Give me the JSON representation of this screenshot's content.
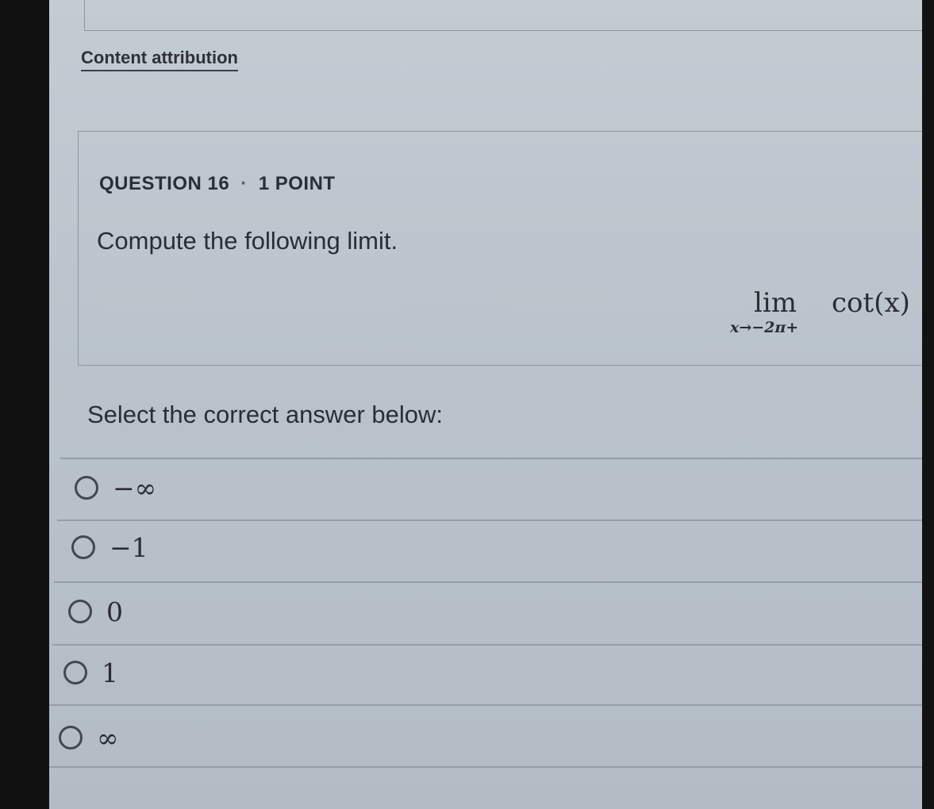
{
  "attribution": {
    "label": "Content attribution"
  },
  "question": {
    "number_label": "QUESTION 16",
    "separator": "·",
    "points_label": "1 POINT",
    "prompt": "Compute the following limit.",
    "math": {
      "lim": "lim",
      "subscript": "x→−2π+",
      "function": "cot(x)"
    }
  },
  "answers": {
    "instruction": "Select the correct answer below:",
    "options": [
      {
        "label": "−∞",
        "selected": false
      },
      {
        "label": "−1",
        "selected": false
      },
      {
        "label": "0",
        "selected": false
      },
      {
        "label": "1",
        "selected": false
      },
      {
        "label": "∞",
        "selected": false
      }
    ]
  }
}
